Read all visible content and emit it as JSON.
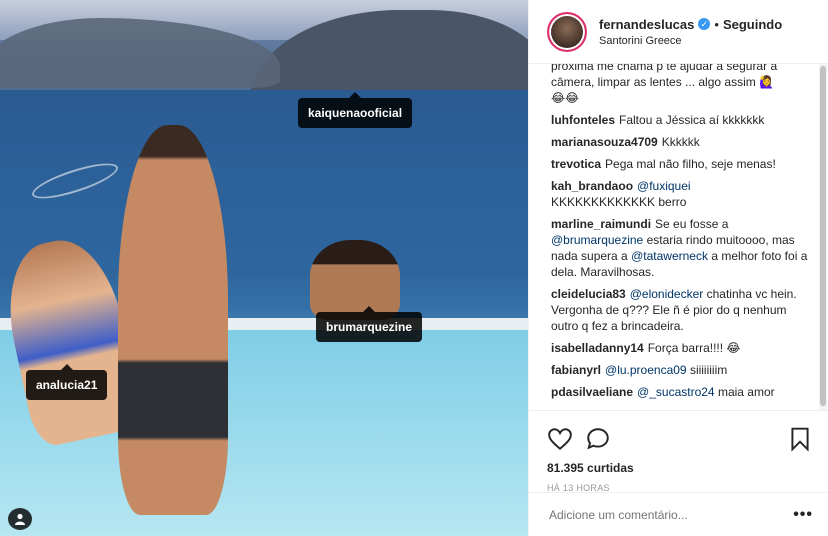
{
  "photo": {
    "tags": [
      {
        "label": "kaiquenaooficial"
      },
      {
        "label": "brumarquezine"
      },
      {
        "label": "analucia21"
      }
    ]
  },
  "header": {
    "username": "fernandeslucas",
    "verified_icon": "check-badge",
    "separator": "•",
    "follow_label": "Seguindo",
    "location": "Santorini Greece"
  },
  "comments": [
    {
      "user": "",
      "text": "próxima me chama p te ajudar a segurar a câmera, limpar as lentes ... algo assim 🙋‍♀️",
      "emoji": "😂😂"
    },
    {
      "user": "luhfonteles",
      "text": "Faltou a Jéssica aí kkkkkkk"
    },
    {
      "user": "marianasouza4709",
      "text": "Kkkkkk"
    },
    {
      "user": "trevotica",
      "text": "Pega mal não filho, seje menas!"
    },
    {
      "user": "kah_brandaoo",
      "mention": "@fuxiquei",
      "text": "KKKKKKKKKKKKK berro"
    },
    {
      "user": "marline_raimundi",
      "text1": "Se eu fosse a",
      "mention1": "@brumarquezine",
      "text2": "estaria rindo muitoooo, mas nada supera a",
      "mention2": "@tatawerneck",
      "text3": "a melhor foto foi a dela. Maravilhosas."
    },
    {
      "user": "cleidelucia83",
      "mention": "@elonidecker",
      "text": "chatinha vc hein. Vergonha de q??? Ele ñ é pior do q nenhum outro q fez a brincadeira."
    },
    {
      "user": "isabelladanny14",
      "text": "Força barra!!!! 😂"
    },
    {
      "user": "fabianyrl",
      "mention": "@lu.proenca09",
      "text": "siiiiiiiim"
    },
    {
      "user": "pdasilvaeliane",
      "mention": "@_sucastro24",
      "text": "maia amor"
    }
  ],
  "actions": {
    "like_icon": "heart-icon",
    "comment_icon": "comment-bubble-icon",
    "save_icon": "bookmark-icon",
    "likes_text": "81.395 curtidas",
    "timestamp": "HÁ 13 HORAS"
  },
  "comment_box": {
    "placeholder": "Adicione um comentário...",
    "more_label": "•••"
  }
}
